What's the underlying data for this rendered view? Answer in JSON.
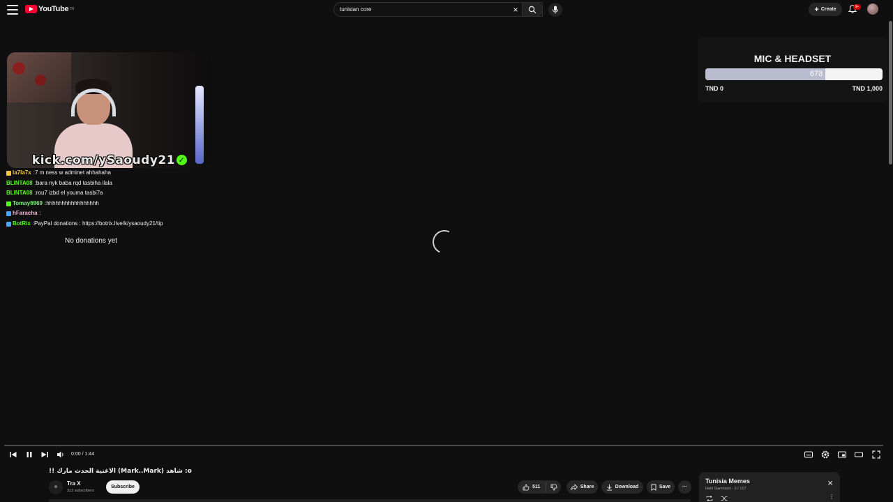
{
  "header": {
    "logo_text": "YouTube",
    "logo_sup": "TN",
    "search_value": "tunisian core",
    "create_label": "Create",
    "notification_badge": "9+"
  },
  "stream": {
    "webcam_label": "kick.com/ySaoudy21",
    "chat": [
      {
        "user": "la7la7x",
        "message": "7 m ness w adminet ahhahaha",
        "user_color": "#f5c542",
        "badge_color": "#f5c542"
      },
      {
        "user": "BLINTA08",
        "message": "bara nyk baba rqd tasbiha ilala",
        "user_color": "#53fc18",
        "badge_color": ""
      },
      {
        "user": "BLINTA08",
        "message": "rou7 izbd el youma tasbi7a",
        "user_color": "#53fc18",
        "badge_color": ""
      },
      {
        "user": "Tomay6969",
        "message": "hhhhhhhhhhhhhhhhh",
        "user_color": "#7cf27c",
        "badge_color": "#53fc18"
      },
      {
        "user": "hFaracha",
        "message": "",
        "user_color": "#f3b7d9",
        "badge_color": "#4aa3ff"
      },
      {
        "user": "BotRix",
        "message": "PayPal donations : https://botrix.live/k/ysaoudy21/tip",
        "user_color": "#53fc18",
        "badge_color": "#4aa3ff"
      }
    ],
    "no_donations": "No donations yet"
  },
  "goal": {
    "title": "MIC & HEADSET",
    "current": 678,
    "target": 1000,
    "min_label": "TND 0",
    "max_label": "TND 1,000"
  },
  "player": {
    "time": "0:00 / 1:44",
    "progress_fraction": 0
  },
  "video": {
    "title": "o: شاهد (Mark..Mark) الاغنية الحدث مارك !!",
    "channel_name": "Tra X",
    "subscribers": "313 subscribers",
    "subscribe_label": "Subscribe",
    "likes": "511",
    "share_label": "Share",
    "download_label": "Download",
    "save_label": "Save"
  },
  "playlist": {
    "title": "Tunisia Memes",
    "subtitle": "Hani Gannouni - 2 / 127"
  },
  "colors": {
    "accent": "#ff0033",
    "kick_green": "#53fc18",
    "goal_fill": "#b8bcce"
  }
}
